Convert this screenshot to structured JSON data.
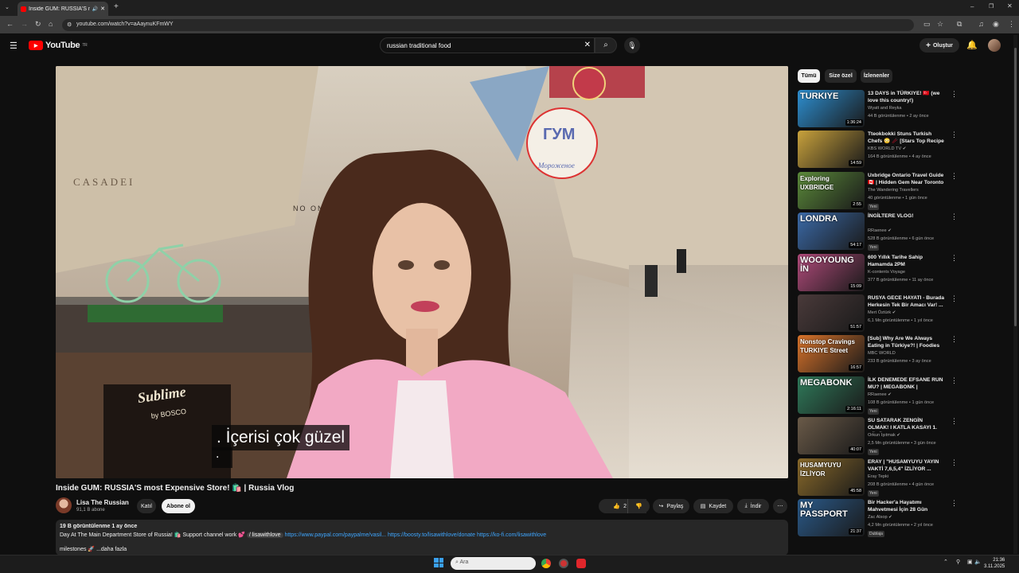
{
  "browser": {
    "tab_title": "Inside GUM: RUSSIA'S mos",
    "url": "youtube.com/watch?v=aAaynuKFmWY"
  },
  "header": {
    "logo": "YouTube",
    "logo_region": "TR",
    "search_value": "russian traditional food",
    "create_label": "Oluştur"
  },
  "video": {
    "caption_line1": ". İçerisi çok güzel",
    "caption_line2": ".",
    "scene_sign_left": "CASADEI",
    "scene_sign_mid": "NO ONE",
    "scene_sign_shop": "Sublime",
    "scene_sign_shop2": "by BOSCO",
    "scene_sign_gum": "ГУМ",
    "scene_sign_ice": "Мороженое"
  },
  "meta": {
    "title": "Inside GUM: RUSSIA'S most Expensive Store! 🛍️ | Russia Vlog",
    "channel": "Lisa The Russian",
    "subscribers": "91,1 B abone",
    "join_label": "Katıl",
    "subscribe_label": "Abone ol",
    "likes": "2 B",
    "share_label": "Paylaş",
    "save_label": "Kaydet",
    "download_label": "İndir"
  },
  "description": {
    "stats": "19 B görüntülenme  1 ay önce",
    "text": "Day At The Main Department Store of Russia! 🛍️ Support channel work 💕",
    "handle": "/ lisawithlove",
    "link1": "https://www.paypal.com/paypalme/vasil...",
    "link2": "https://boosty.to/lisawithlove/donate",
    "link3": "https://ko-fi.com/lisawithlove",
    "line2": "milestones 🚀  ...daha fazla"
  },
  "chips": [
    "Tümü",
    "Size özel",
    "İzlenenler"
  ],
  "recommendations": [
    {
      "title": "13 DAYS in TÜRKIYE! 🇹🇷 (we love this country!)",
      "channel": "Wyatt and Reyka",
      "meta": "44 B görüntülenme • 2 ay önce",
      "duration": "1:36:24",
      "badge": "",
      "thumb_text": "TURKIYE",
      "color": "#2d8fd1"
    },
    {
      "title": "Tteokbokki Stuns Turkish Chefs 😳 🥢 [Stars Top Recipe at Fu...",
      "channel": "KBS WORLD TV ✔",
      "meta": "164 B görüntülenme • 4 ay önce",
      "duration": "14:59",
      "badge": "",
      "thumb_text": "",
      "color": "#c9a23c"
    },
    {
      "title": "Uxbridge Ontario Travel Guide 🇨🇦 | Hidden Gem Near Toronto",
      "channel": "The Wandering Travellers",
      "meta": "40 görüntülenme • 1 gün önce",
      "duration": "2:55",
      "badge": "Yeni",
      "thumb_text": "Exploring UXBRIDGE",
      "color": "#5b8a3a"
    },
    {
      "title": "İNGİLTERE VLOG!",
      "channel": "RRaenee ✔",
      "meta": "528 B görüntülenme • 6 gün önce",
      "duration": "54:17",
      "badge": "Yeni",
      "thumb_text": "LONDRA",
      "color": "#3b6aa8"
    },
    {
      "title": "600 Yıllık Tarihe Sahip Hamamda 2PM WOOYOUNG'u...",
      "channel": "K-contents Voyage",
      "meta": "377 B görüntülenme • 11 ay önce",
      "duration": "15:09",
      "badge": "",
      "thumb_text": "WOOYOUNG İN",
      "color": "#b04a7a"
    },
    {
      "title": "RUSYA GECE HAYATI - Burada Herkesin Tek Bir Amacı Var! ...",
      "channel": "Mert Öztürk ✔",
      "meta": "6,1 Mn görüntülenme • 1 yıl önce",
      "duration": "51:57",
      "badge": "",
      "thumb_text": "",
      "color": "#4a3a3a"
    },
    {
      "title": "[Sub] Why Are We Always Eating in Türkiye?! | Foodies Can't ...",
      "channel": "MBC WORLD",
      "meta": "233 B görüntülenme • 3 ay önce",
      "duration": "16:57",
      "badge": "",
      "thumb_text": "Nonstop Cravings TURKIYE Street",
      "color": "#d9732a"
    },
    {
      "title": "İLK DENEMEDE EFSANE RUN MU? | MEGABONK |",
      "channel": "RRaenee ✔",
      "meta": "108 B görüntülenme • 1 gün önce",
      "duration": "2:16:11",
      "badge": "Yeni",
      "thumb_text": "MEGABONK",
      "color": "#2f7a5a"
    },
    {
      "title": "SU SATARAK ZENGİN OLMAK! I KATLA KASAYI 1. BÖLÜM ...",
      "channel": "Orkun Işıtmak ✔",
      "meta": "2,5 Mn görüntülenme • 3 gün önce",
      "duration": "40:07",
      "badge": "Yeni",
      "thumb_text": "",
      "color": "#6a5a48"
    },
    {
      "title": "ERAY | \"HUSAMYUYU YAYIN VAKTİ 7,6,5,4\" İZLİYOR ...",
      "channel": "Eray Tepki",
      "meta": "208 B görüntülenme • 4 gün önce",
      "duration": "45:58",
      "badge": "Yeni",
      "thumb_text": "HUSAMYUYU İZLİYOR",
      "color": "#8a6a2a"
    },
    {
      "title": "Bir Hacker'a Hayatımı Mahvetmesi İçin 28 Gün Verdim",
      "channel": "Zac Alsop ✔",
      "meta": "4,2 Mn görüntülenme • 2 yıl önce",
      "duration": "21:37",
      "badge": "Dublaja",
      "thumb_text": "MY PASSPORT",
      "color": "#2a5a8a"
    }
  ],
  "taskbar": {
    "search_placeholder": "Ara",
    "time": "21:36",
    "date": "3.11.2025"
  }
}
